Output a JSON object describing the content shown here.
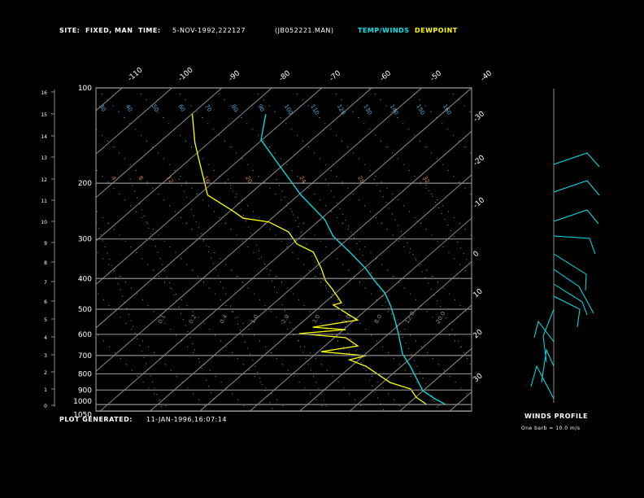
{
  "header": {
    "site_label": "SITE:",
    "site_value": "FIXED, MAN",
    "time_label": "TIME:",
    "time_value": "5-NOV-1992,222127",
    "file": "(JB052221.MAN)",
    "legend_temp": "TEMP/WINDS",
    "legend_dewpoint": "DEWPOINT"
  },
  "footer": {
    "generated_label": "PLOT GENERATED:",
    "generated_value": "11-JAN-1996,16:07:14"
  },
  "winds": {
    "title": "WINDS PROFILE",
    "note": "One barb = 10.0 m/s"
  },
  "colors": {
    "background": "#000000",
    "temp": "#00e5ee",
    "dewpoint": "#ffff00",
    "grid": "#8c8c8c",
    "dry_adiabat": "#5aaee0",
    "mixing_ratio": "#d2824a",
    "text": "#ffffff"
  },
  "chart_data": {
    "type": "line",
    "title": "",
    "xlabel": "",
    "ylabel": "",
    "y_scale": "log-pressure",
    "ylim": [
      1050,
      100
    ],
    "pressure_ticks": [
      "100",
      "200",
      "300",
      "400",
      "500",
      "600",
      "700",
      "800",
      "900",
      "1000",
      "1050"
    ],
    "height_ticks_km": [
      "0",
      "1",
      "2",
      "3",
      "4",
      "5",
      "6",
      "7",
      "8",
      "9",
      "10",
      "11",
      "12",
      "13",
      "14",
      "15",
      "16"
    ],
    "top_temperature_ticks": [
      "-110",
      "-100",
      "-90",
      "-80",
      "-70",
      "-60",
      "-50",
      "-40"
    ],
    "right_temperature_ticks": [
      "-30",
      "-20",
      "-10",
      "0",
      "10",
      "20",
      "30"
    ],
    "dry_adiabat_labels": [
      "30",
      "40",
      "50",
      "60",
      "70",
      "80",
      "90",
      "100",
      "110",
      "120",
      "130",
      "140",
      "150",
      "160"
    ],
    "mixing_ratio_labels": [
      "4",
      "8",
      "12",
      "16",
      "20",
      "24",
      "28",
      "32"
    ],
    "mid_labels": [
      "0.1",
      "0.2",
      "0.4",
      "1.0",
      "2.0",
      "3.0",
      "5.0",
      "8.0",
      "12.0",
      "20.0"
    ],
    "series": [
      {
        "name": "TEMP/WINDS",
        "points": [
          [
            121,
            -75.2
          ],
          [
            146,
            -70.2
          ],
          [
            164,
            -64.2
          ],
          [
            185,
            -58.0
          ],
          [
            218,
            -49.5
          ],
          [
            261,
            -39.0
          ],
          [
            294,
            -33.6
          ],
          [
            330,
            -26.6
          ],
          [
            372,
            -19.6
          ],
          [
            406,
            -15.1
          ],
          [
            444,
            -10.2
          ],
          [
            485,
            -6.3
          ],
          [
            530,
            -2.7
          ],
          [
            597,
            1.9
          ],
          [
            692,
            7.4
          ],
          [
            757,
            11.8
          ],
          [
            852,
            17.2
          ],
          [
            904,
            19.9
          ],
          [
            959,
            24.2
          ],
          [
            1000,
            27.7
          ]
        ]
      },
      {
        "name": "DEWPOINT",
        "points": [
          [
            121,
            -89.9
          ],
          [
            149,
            -82.8
          ],
          [
            172,
            -77.3
          ],
          [
            218,
            -68.2
          ],
          [
            243,
            -60.0
          ],
          [
            258,
            -55.7
          ],
          [
            265,
            -49.8
          ],
          [
            285,
            -43.5
          ],
          [
            311,
            -39.1
          ],
          [
            330,
            -33.9
          ],
          [
            372,
            -28.5
          ],
          [
            406,
            -24.9
          ],
          [
            431,
            -21.7
          ],
          [
            477,
            -16.6
          ],
          [
            485,
            -17.7
          ],
          [
            541,
            -9.4
          ],
          [
            570,
            -16.7
          ],
          [
            580,
            -9.6
          ],
          [
            597,
            -18.0
          ],
          [
            615,
            -7.7
          ],
          [
            653,
            -3.4
          ],
          [
            681,
            -9.4
          ],
          [
            701,
            0.5
          ],
          [
            722,
            -1.9
          ],
          [
            757,
            2.9
          ],
          [
            852,
            11.5
          ],
          [
            893,
            17.1
          ],
          [
            948,
            20.1
          ],
          [
            1000,
            23.9
          ]
        ]
      }
    ]
  }
}
